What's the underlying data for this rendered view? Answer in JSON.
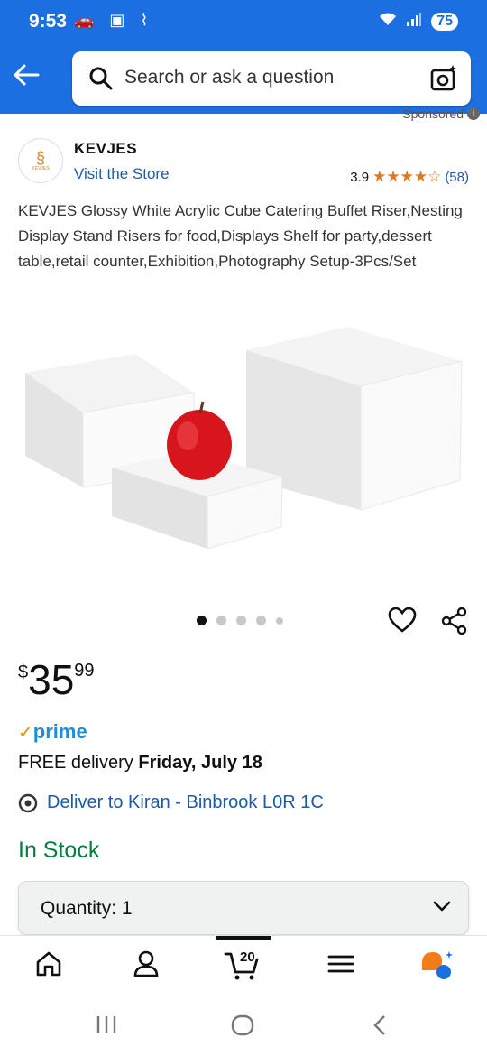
{
  "status_bar": {
    "time": "9:53",
    "battery": "75"
  },
  "search": {
    "placeholder": "Search or ask a question"
  },
  "sponsored": "Sponsored",
  "brand": {
    "name": "KEVJES",
    "visit_store": "Visit the Store",
    "logo_text": "KEVJES"
  },
  "rating": {
    "value": "3.9",
    "stars": "★★★★☆",
    "count": "(58)"
  },
  "product": {
    "title": "KEVJES Glossy White Acrylic Cube Catering Buffet Riser,Nesting Display Stand Risers for food,Displays Shelf for party,dessert table,retail counter,Exhibition,Photography Setup-3Pcs/Set",
    "image_count": 5,
    "active_image": 1
  },
  "price": {
    "currency": "$",
    "whole": "35",
    "fraction": "99"
  },
  "prime": {
    "label": "prime"
  },
  "delivery": {
    "prefix": "FREE delivery ",
    "date": "Friday, July 18"
  },
  "deliver_to": "Deliver to Kiran - Binbrook L0R 1C",
  "stock": "In Stock",
  "quantity": {
    "label": "Quantity: 1"
  },
  "bottom_nav": {
    "cart_count": "20"
  },
  "colors": {
    "header_blue": "#1b6fe0",
    "link_blue": "#1f5aa8",
    "star_orange": "#de7921",
    "in_stock_green": "#067d3e",
    "prime_blue": "#1f8ed8"
  }
}
